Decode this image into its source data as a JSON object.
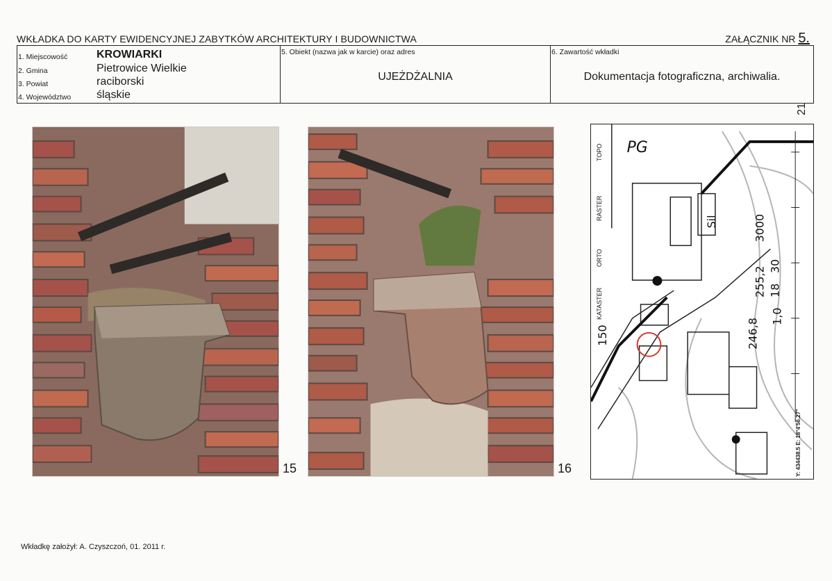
{
  "header": {
    "title": "WKŁADKA DO KARTY EWIDENCYJNEJ ZABYTKÓW ARCHITEKTURY I BUDOWNICTWA",
    "annex_label": "ZAŁĄCZNIK NR",
    "annex_number": "5."
  },
  "info": {
    "locality_label": "1. Miejscowość",
    "locality_value": "KROWIARKI",
    "commune_label": "2. Gmina",
    "commune_value": "Pietrowice Wielkie",
    "district_label": "3. Powiat",
    "district_value": "raciborski",
    "voivodeship_label": "4. Województwo",
    "voivodeship_value": "śląskie",
    "object_label": "5. Obiekt (nazwa jak w karcie) oraz adres",
    "object_value": "UJEŻDŻALNIA",
    "contents_label": "6. Zawartość wkładki",
    "contents_value": "Dokumentacja fotograficzna, archiwalia."
  },
  "photos": [
    {
      "number": "15",
      "icon": "photo-brick-corbel"
    },
    {
      "number": "16",
      "icon": "photo-brick-corbel"
    }
  ],
  "map": {
    "layer_labels": [
      "TOPO",
      "RASTER",
      "ORTO",
      "KATASTER"
    ],
    "text_pg": "PG",
    "text_sil": "Sil",
    "elevations": [
      "255,2",
      "3000",
      "18",
      "30",
      "246,8",
      "1,0",
      "150"
    ],
    "coords": "Y: 434438.5 E: 18°4'56.27\"",
    "marker_color": "#d23a2a"
  },
  "page_number": "21",
  "footer": "Wkładkę założył: A. Czyszczoń, 01. 2011 r."
}
